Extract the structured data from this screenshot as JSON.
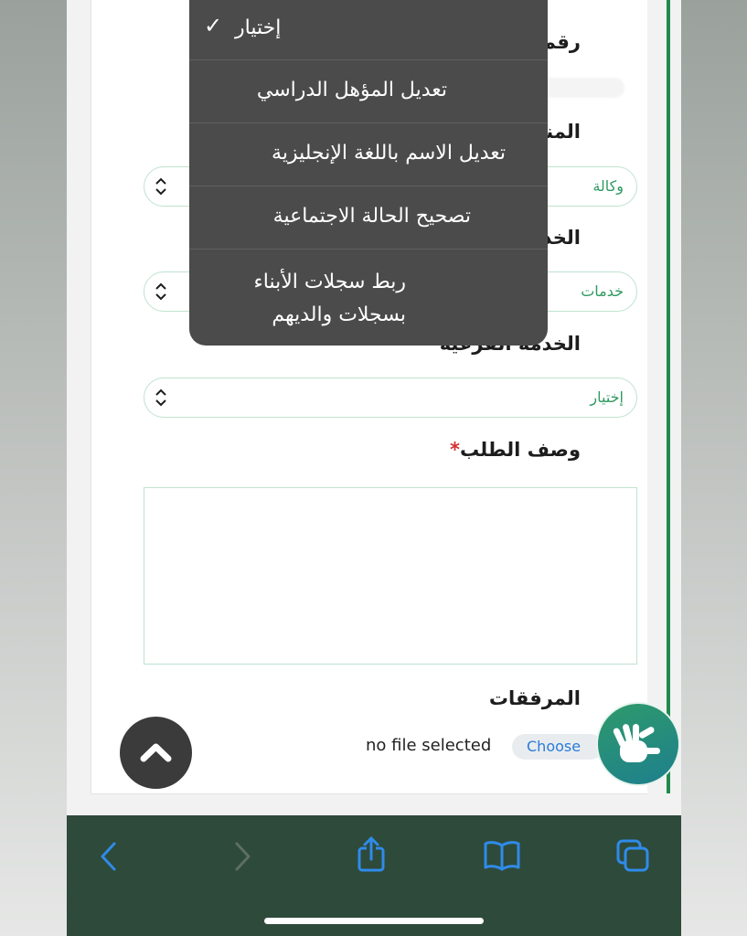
{
  "form": {
    "id_label": "رقم الج",
    "region_label": "المنطقة",
    "agency_value": "وكالة",
    "service_label": "الخدمة",
    "service_value": "خدمات",
    "subservice_label": "الخدمة الفرعية",
    "subservice_value": "إختيار",
    "description_label": "وصف الطلب",
    "required_mark": "*",
    "attachments_label": "المرفقات",
    "no_file_text": "no file selected",
    "choose_label": "Choose"
  },
  "dropdown": {
    "items": [
      {
        "label": "إختيار",
        "checked": true
      },
      {
        "label": "تعديل المؤهل الدراسي"
      },
      {
        "label": "تعديل الاسم باللغة الإنجليزية"
      },
      {
        "label": "تصحيح الحالة الاجتماعية"
      },
      {
        "label": "ربط سجلات الأبناء بسجلات والديهم"
      }
    ]
  },
  "toolbar": {
    "icons": [
      "back-icon",
      "forward-icon",
      "share-icon",
      "bookmarks-icon",
      "tabs-icon"
    ],
    "accent": "#2f8bea"
  },
  "colors": {
    "brand_green": "#1f8a4c",
    "field_text": "#2f9a62",
    "dropdown_bg": "#4b4b4b",
    "toolbar_bg": "#2e4a3a"
  }
}
